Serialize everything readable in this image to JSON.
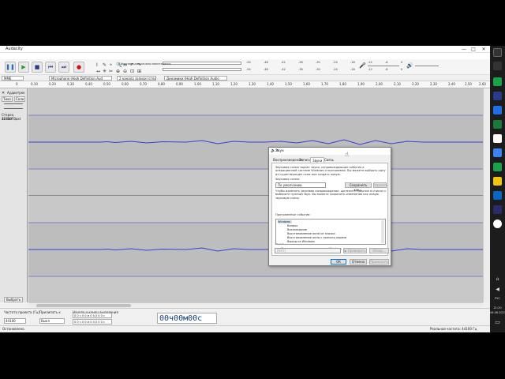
{
  "app": {
    "title": "Audacity",
    "menu": [
      "Файл",
      "Правка",
      "Выделить",
      "Вид",
      "Транспорт",
      "Треки",
      "Создать",
      "Эффекты",
      "Анализ",
      "Инструменты",
      "Справка"
    ],
    "win_buttons": [
      "—",
      "□",
      "✕"
    ]
  },
  "toolbar": {
    "pause": "❚❚",
    "play": "▶",
    "stop": "■",
    "skip_start": "⏮",
    "skip_end": "⏭",
    "record": "●",
    "rec_meter_label": "Щёлкните для начала мониторинга",
    "meter_ticks": [
      "-54",
      "-48",
      "-42",
      "-36",
      "-30",
      "-24",
      "-18",
      "-12",
      "-6",
      "0"
    ],
    "play_meter_ticks": [
      "-54",
      "-48",
      "-42",
      "-36",
      "-30",
      "-24",
      "-18",
      "-12",
      "-6",
      "0"
    ]
  },
  "devices": {
    "host": "MME",
    "input": "Microphone (High Definition Aud",
    "channels": "2 канала записи (стерео)",
    "output": "Динамики (High Definition Audio"
  },
  "ruler": {
    "ticks": [
      "0",
      "0,10",
      "0,20",
      "0,30",
      "0,40",
      "0,50",
      "0,60",
      "0,70",
      "0,80",
      "0,90",
      "1,00",
      "1,10",
      "1,20",
      "1,30",
      "1,40",
      "1,50",
      "1,60",
      "1,70",
      "1,80",
      "1,90",
      "2,00",
      "2,10",
      "2,20",
      "2,30",
      "2,40",
      "2,50",
      "2,60"
    ]
  },
  "track": {
    "name": "Аудиотрек",
    "mute": "Тихо",
    "solo": "Соло",
    "info": "Стерео, 44100Гц",
    "info2": "32-бит float",
    "select": "Выбрать",
    "scale": [
      "1,0",
      "0,5",
      "0,0",
      "-0,5",
      "-1,0",
      "1,0",
      "0,5",
      "0,0",
      "-0,5",
      "-1,0"
    ]
  },
  "selection": {
    "rate_label": "Частота проекта (Гц)",
    "rate_value": "44100",
    "snap_label": "Прилипать к",
    "snap_value": "Выкл",
    "range_label": "Начало и конец выделения",
    "start": "0 0 ч 0 0 м 0 0,0 0 0 с",
    "end": "0 0 ч 0 0 м 0 0,0 0 0 с",
    "timecode": "00ч00м00с"
  },
  "status": {
    "left": "Остановлено.",
    "right": "Реальная частота: 44100 Гц"
  },
  "dialog": {
    "title": "Звук",
    "tabs": [
      "Воспроизведение",
      "Запись",
      "Звуки",
      "Связь"
    ],
    "intro": "Звуковая схема задает звуки, сопровождающие события в операционной системе Windows и программах. Вы можете выбрать одну из существующих схем или создать новую.",
    "scheme_label": "Звуковая схема:",
    "scheme_value": "По умолчанию",
    "save_as": "Сохранить как...",
    "delete": "Удалить",
    "hint": "Чтобы изменить звуковое сопровождение, щелкните событие в списке и выберите нужный звук. Вы можете сохранить изменения как новую звуковую схему.",
    "events_label": "Программные события:",
    "events": [
      "Windows",
      "Вопрос",
      "Восклицание",
      "Восстановление окна из значка",
      "Восстановление окна с полного экрана",
      "Выход из Windows"
    ],
    "startup_check": "Проигрывать мелодию запуска Windows",
    "sounds_label": "Звуки:",
    "sound_value": "(Нет)",
    "check_btn": "▶ Проверить",
    "browse_btn": "Обзор...",
    "ok": "ОК",
    "cancel": "Отмена",
    "apply": "Применить"
  },
  "taskbar": {
    "time": "21:20",
    "date": "06.06.2021",
    "lang": "РУС"
  },
  "colors": {
    "waveform": "#3a3fcf",
    "track_bg": "#c8c8c8",
    "accent": "#0078d7"
  }
}
